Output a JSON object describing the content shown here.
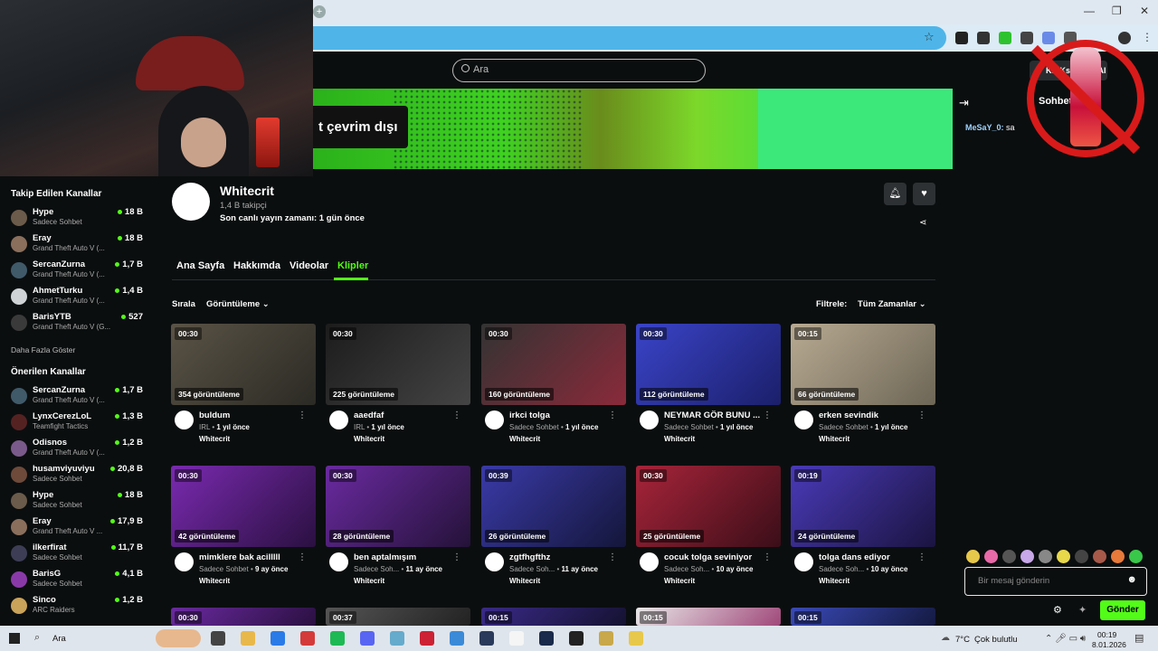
{
  "browser": {
    "new_tab_symbol": "+",
    "window_controls": [
      "—",
      "❐",
      "✕"
    ],
    "star_symbol": "☆"
  },
  "header": {
    "search_placeholder": "Ara",
    "kick_button": "KICKs",
    "kick_button_suffix": "AI"
  },
  "banner": {
    "offline_text": "t çevrim dışı"
  },
  "channel": {
    "name": "Whitecrit",
    "followers": "1,4 B takipçi",
    "last_stream": "Son canlı yayın zamanı: 1 gün önce"
  },
  "tabs": [
    "Ana Sayfa",
    "Hakkımda",
    "Videolar",
    "Klipler"
  ],
  "controls": {
    "sort_label": "Sırala",
    "sort_value": "Görüntüleme",
    "filter_label": "Filtrele:",
    "filter_value": "Tüm Zamanlar"
  },
  "sidebar": {
    "followed_title": "Takip Edilen Kanallar",
    "followed": [
      {
        "name": "Hype",
        "game": "Sadece Sohbet",
        "viewers": "18 B",
        "color": "#6b5b4a"
      },
      {
        "name": "Eray",
        "game": "Grand Theft Auto V (...",
        "viewers": "18 B",
        "color": "#8a6f5c"
      },
      {
        "name": "SercanZurna",
        "game": "Grand Theft Auto V (...",
        "viewers": "1,7 B",
        "color": "#405a6a"
      },
      {
        "name": "AhmetTurku",
        "game": "Grand Theft Auto V (...",
        "viewers": "1,4 B",
        "color": "#cfd3d6"
      },
      {
        "name": "BarisYTB",
        "game": "Grand Theft Auto V (G...",
        "viewers": "527",
        "color": "#3a3a3a"
      }
    ],
    "more_label": "Daha Fazla Göster",
    "recommended_title": "Önerilen Kanallar",
    "recommended": [
      {
        "name": "SercanZurna",
        "game": "Grand Theft Auto V (...",
        "viewers": "1,7 B",
        "color": "#405a6a"
      },
      {
        "name": "LynxCerezLoL",
        "game": "Teamfight Tactics",
        "viewers": "1,3 B",
        "color": "#552222"
      },
      {
        "name": "Odisnos",
        "game": "Grand Theft Auto V (...",
        "viewers": "1,2 B",
        "color": "#7a5a8a"
      },
      {
        "name": "husamviyuviyu",
        "game": "Sadece Sohbet",
        "viewers": "20,8 B",
        "color": "#6d4a3a"
      },
      {
        "name": "Hype",
        "game": "Sadece Sohbet",
        "viewers": "18 B",
        "color": "#6b5b4a"
      },
      {
        "name": "Eray",
        "game": "Grand Theft Auto V ...",
        "viewers": "17,9 B",
        "color": "#8a6f5c"
      },
      {
        "name": "ilkerfirat",
        "game": "Sadece Sohbet",
        "viewers": "11,7 B",
        "color": "#3d3d55"
      },
      {
        "name": "BarisG",
        "game": "Sadece Sohbet",
        "viewers": "4,1 B",
        "color": "#8a3aa8"
      },
      {
        "name": "Sinco",
        "game": "ARC Raiders",
        "viewers": "1,2 B",
        "color": "#c9a35a"
      }
    ]
  },
  "clips": [
    {
      "duration": "00:30",
      "views": "354 görüntüleme",
      "title": "buldum",
      "category": "IRL",
      "age": "1 yıl önce",
      "author": "Whitecrit",
      "colors": [
        "#5a5346",
        "#2b2a24"
      ]
    },
    {
      "duration": "00:30",
      "views": "225 görüntüleme",
      "title": "aaedfaf",
      "category": "IRL",
      "age": "1 yıl önce",
      "author": "Whitecrit",
      "colors": [
        "#1c1c1c",
        "#444"
      ]
    },
    {
      "duration": "00:30",
      "views": "160 görüntüleme",
      "title": "irkci tolga",
      "category": "Sadece Sohbet",
      "age": "1 yıl önce",
      "author": "Whitecrit",
      "colors": [
        "#333",
        "#8a2a3a"
      ]
    },
    {
      "duration": "00:30",
      "views": "112 görüntüleme",
      "title": "NEYMAR GÖR BUNU ...",
      "category": "Sadece Sohbet",
      "age": "1 yıl önce",
      "author": "Whitecrit",
      "colors": [
        "#3a44c8",
        "#1b1f6a"
      ]
    },
    {
      "duration": "00:15",
      "views": "66 görüntüleme",
      "title": "erken sevindik",
      "category": "Sadece Sohbet",
      "age": "1 yıl önce",
      "author": "Whitecrit",
      "colors": [
        "#b8aa92",
        "#6d6656"
      ]
    },
    {
      "duration": "00:30",
      "views": "42 görüntüleme",
      "title": "mimklere bak acilllll",
      "category": "Sadece Sohbet",
      "age": "9 ay önce",
      "author": "Whitecrit",
      "colors": [
        "#7a2ab0",
        "#2a1040"
      ]
    },
    {
      "duration": "00:30",
      "views": "28 görüntüleme",
      "title": "ben aptalmışım",
      "category": "Sadece Soh...",
      "age": "11 ay önce",
      "author": "Whitecrit",
      "colors": [
        "#6a2aa0",
        "#241238"
      ]
    },
    {
      "duration": "00:39",
      "views": "26 görüntüleme",
      "title": "zgtfhgfthz",
      "category": "Sadece Soh...",
      "age": "11 ay önce",
      "author": "Whitecrit",
      "colors": [
        "#3a3aa8",
        "#14163a"
      ]
    },
    {
      "duration": "00:30",
      "views": "25 görüntüleme",
      "title": "cocuk tolga seviniyor",
      "category": "Sadece Soh...",
      "age": "10 ay önce",
      "author": "Whitecrit",
      "colors": [
        "#a8243a",
        "#3a0e18"
      ]
    },
    {
      "duration": "00:19",
      "views": "24 görüntüleme",
      "title": "tolga dans ediyor",
      "category": "Sadece Soh...",
      "age": "10 ay önce",
      "author": "Whitecrit",
      "colors": [
        "#4a3ab8",
        "#1a1440"
      ]
    },
    {
      "duration": "00:30",
      "views": "",
      "title": "",
      "category": "",
      "age": "",
      "author": "",
      "colors": [
        "#6a2aa0",
        "#2a1040"
      ]
    },
    {
      "duration": "00:37",
      "views": "",
      "title": "",
      "category": "",
      "age": "",
      "author": "",
      "colors": [
        "#555",
        "#222"
      ]
    },
    {
      "duration": "00:15",
      "views": "",
      "title": "",
      "category": "",
      "age": "",
      "author": "",
      "colors": [
        "#3a2a88",
        "#141230"
      ]
    },
    {
      "duration": "00:15",
      "views": "",
      "title": "",
      "category": "",
      "age": "",
      "author": "",
      "colors": [
        "#e8e8e8",
        "#a0487a"
      ]
    },
    {
      "duration": "00:15",
      "views": "",
      "title": "",
      "category": "",
      "age": "",
      "author": "",
      "colors": [
        "#3a4ab8",
        "#141a40"
      ]
    }
  ],
  "chat": {
    "title": "Sohbet",
    "messages": [
      {
        "user": "MeSaY_0:",
        "text": "sa"
      }
    ],
    "input_placeholder": "Bir mesaj gönderin",
    "send_label": "Gönder"
  },
  "taskbar": {
    "search_label": "Ara",
    "weather_temp": "7°C",
    "weather_text": "Çok bulutlu",
    "time": "00:19",
    "date": "8.01.2026"
  }
}
